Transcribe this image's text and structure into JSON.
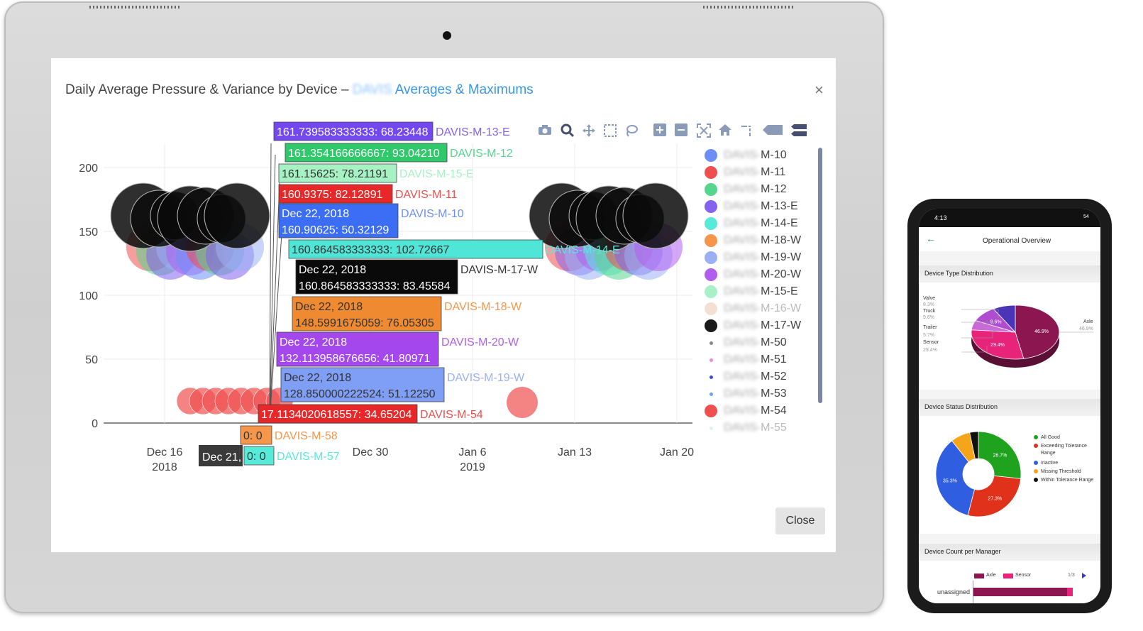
{
  "modal": {
    "title_main": "Daily Average Pressure & Variance by Device –",
    "title_blur": "DAVIS",
    "title_link": "Averages & Maximums",
    "close_icon": "×",
    "close_label": "Close"
  },
  "toolbar": {
    "icons": [
      "camera-icon",
      "zoom-icon",
      "pan-icon",
      "box-select-icon",
      "lasso-icon",
      "zoom-in-icon",
      "zoom-out-icon",
      "autoscale-icon",
      "home-icon",
      "spike-lines-icon",
      "hover-closest-icon",
      "hover-compare-icon"
    ]
  },
  "legend": {
    "prefix": "DAVIS-",
    "items": [
      {
        "label": "M-10",
        "color": "#6e8ef7",
        "size": "big"
      },
      {
        "label": "M-11",
        "color": "#ef4f4f",
        "size": "big"
      },
      {
        "label": "M-12",
        "color": "#55d68d",
        "size": "big"
      },
      {
        "label": "M-13-E",
        "color": "#8463f0",
        "size": "big"
      },
      {
        "label": "M-14-E",
        "color": "#58ead9",
        "size": "big"
      },
      {
        "label": "M-18-W",
        "color": "#f5964b",
        "size": "big"
      },
      {
        "label": "M-19-W",
        "color": "#9ab0f5",
        "size": "big"
      },
      {
        "label": "M-20-W",
        "color": "#b15ef0",
        "size": "big"
      },
      {
        "label": "M-15-E",
        "color": "#a8f0c6",
        "size": "big"
      },
      {
        "label": "M-16-W",
        "color": "#e8c2a8",
        "size": "big",
        "faded": true
      },
      {
        "label": "M-17-W",
        "color": "#1a1a1a",
        "size": "big"
      },
      {
        "label": "M-50",
        "color": "#888888",
        "size": "small"
      },
      {
        "label": "M-51",
        "color": "#f08ad8",
        "size": "small"
      },
      {
        "label": "M-52",
        "color": "#3a4fd6",
        "size": "small"
      },
      {
        "label": "M-53",
        "color": "#6a9ef2",
        "size": "small"
      },
      {
        "label": "M-54",
        "color": "#ef4f4f",
        "size": "big"
      },
      {
        "label": "M-55",
        "color": "#b8f0c8",
        "size": "small",
        "faded": true
      }
    ]
  },
  "chart_data": {
    "type": "scatter",
    "ylim": [
      0,
      220
    ],
    "yticks": [
      "0",
      "50",
      "100",
      "150",
      "200"
    ],
    "xticks": [
      {
        "line1": "Dec 16",
        "line2": "2018"
      },
      {
        "line1": "Dec 30",
        "line2": ""
      },
      {
        "line1": "Jan 6",
        "line2": "2019"
      },
      {
        "line1": "Jan 13",
        "line2": ""
      },
      {
        "line1": "Jan 20",
        "line2": ""
      }
    ],
    "hover_labels": [
      {
        "text1": "",
        "text2": "161.739583333333: 68.23448",
        "device": "DAVIS-M-13-E",
        "color": "#7448f0",
        "textcolor": "#ffffff",
        "devcolor": "#8463f0"
      },
      {
        "text1": "",
        "text2": "161.354166666667: 93.04210",
        "device": "DAVIS-M-12",
        "color": "#2fc86a",
        "textcolor": "#ffffff",
        "devcolor": "#55d68d"
      },
      {
        "text1": "",
        "text2": "161.15625: 78.21191",
        "device": "DAVIS-M-15-E",
        "color": "#a6f2c4",
        "textcolor": "#333333",
        "devcolor": "#a8f0c6"
      },
      {
        "text1": "",
        "text2": "160.9375: 82.12891",
        "device": "DAVIS-M-11",
        "color": "#e82828",
        "textcolor": "#ffffff",
        "devcolor": "#ef4f4f"
      },
      {
        "text1": "Dec 22, 2018",
        "text2": "160.90625: 50.32129",
        "device": "DAVIS-M-10",
        "color": "#3b6ef5",
        "textcolor": "#ffffff",
        "devcolor": "#6e8ef7"
      },
      {
        "text1": "",
        "text2": "160.864583333333: 102.72667",
        "device": "DAVIS-M-14-E",
        "color": "#4fe6d8",
        "textcolor": "#333333",
        "devcolor": "#58ead9"
      },
      {
        "text1": "Dec 22, 2018",
        "text2": "160.864583333333: 83.45584",
        "device": "DAVIS-M-17-W",
        "color": "#0a0a0a",
        "textcolor": "#ffffff",
        "devcolor": "#333333"
      },
      {
        "text1": "Dec 22, 2018",
        "text2": "148.5991675059: 76.05305",
        "device": "DAVIS-M-18-W",
        "color": "#f08a30",
        "textcolor": "#333333",
        "devcolor": "#f5964b"
      },
      {
        "text1": "Dec 22, 2018",
        "text2": "132.113958676656: 41.80971",
        "device": "DAVIS-M-20-W",
        "color": "#a448ee",
        "textcolor": "#ffffff",
        "devcolor": "#b15ef0"
      },
      {
        "text1": "Dec 22, 2018",
        "text2": "128.850000222524: 51.12250",
        "device": "DAVIS-M-19-W",
        "color": "#7f9ef5",
        "textcolor": "#333333",
        "devcolor": "#9ab0f5"
      },
      {
        "text1": "",
        "text2": "17.1134020618557: 34.65204",
        "device": "DAVIS-M-54",
        "color": "#e82828",
        "textcolor": "#ffffff",
        "devcolor": "#ef4f4f"
      },
      {
        "text1": "",
        "text2": "0: 0",
        "device": "DAVIS-M-58",
        "color": "#f5964b",
        "textcolor": "#333333",
        "devcolor": "#f5964b"
      },
      {
        "text1": "",
        "text2": "0: 0",
        "device": "DAVIS-M-57",
        "color": "#58ead9",
        "textcolor": "#333333",
        "devcolor": "#58ead9"
      }
    ],
    "x_hover_label": "Dec 21,"
  },
  "phone": {
    "status_time": "4:13",
    "status_right": "54",
    "header_title": "Operational Overview",
    "back_icon": "←",
    "card1": {
      "title": "Device Type Distribution",
      "labels": [
        {
          "name": "Valve",
          "pct": "8.3%"
        },
        {
          "name": "Truck",
          "pct": "9.6%"
        },
        {
          "name": "Trailer",
          "pct": "5.7%"
        },
        {
          "name": "Sensor",
          "pct": "29.4%"
        },
        {
          "name": "Axle",
          "pct": "46.9%"
        }
      ],
      "slices": [
        {
          "name": "Axle",
          "value": 46.9,
          "color": "#8b1650",
          "label": "46.9%"
        },
        {
          "name": "Sensor",
          "value": 29.4,
          "color": "#e8247a",
          "label": "29.4%"
        },
        {
          "name": "Trailer",
          "value": 5.7,
          "color": "#c86ad8",
          "label": ""
        },
        {
          "name": "Truck",
          "value": 9.6,
          "color": "#b04cd0",
          "label": "9.6%"
        },
        {
          "name": "Valve",
          "value": 8.3,
          "color": "#4a34b8",
          "label": ""
        }
      ]
    },
    "card2": {
      "title": "Device Status Distribution",
      "slices": [
        {
          "name": "All Good",
          "value": 26.7,
          "color": "#1fa31f",
          "label": "26.7%"
        },
        {
          "name": "Exceeding Tolerance Range",
          "value": 27.3,
          "color": "#e0321a",
          "label": "27.3%"
        },
        {
          "name": "Inactive",
          "value": 35.3,
          "color": "#2f5fe0",
          "label": "35.3%"
        },
        {
          "name": "Missing Threshold",
          "value": 7.4,
          "color": "#f5a51a",
          "label": ""
        },
        {
          "name": "Within Tolerance Range",
          "value": 3.3,
          "color": "#111111",
          "label": ""
        }
      ],
      "legend": [
        "All Good",
        "Exceeding Tolerance Range",
        "Inactive",
        "Missing Threshold",
        "Within Tolerance Range"
      ]
    },
    "card3": {
      "title": "Device Count per Manager",
      "legend": [
        {
          "name": "Axle",
          "color": "#8b1650"
        },
        {
          "name": "Sensor",
          "color": "#e8247a"
        }
      ],
      "page": "1/3",
      "row_label": "unassigned"
    }
  }
}
